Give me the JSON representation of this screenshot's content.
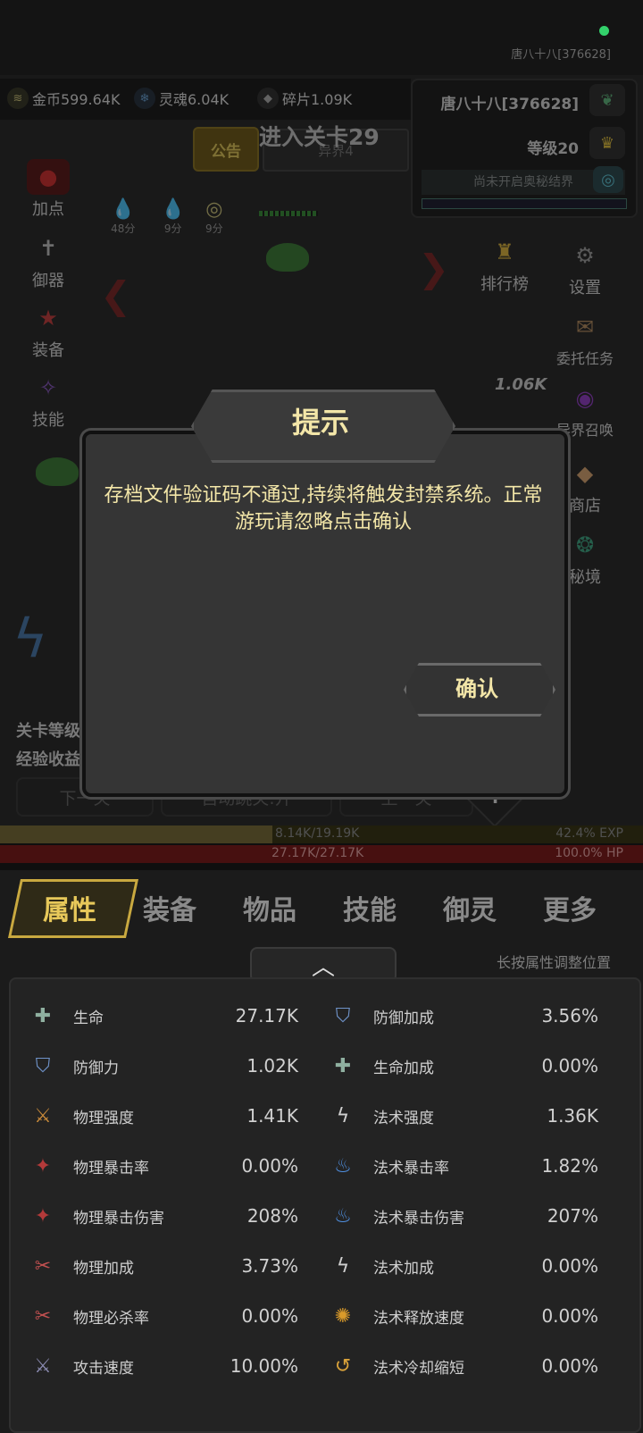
{
  "status": {
    "user": "唐八十八[376628]"
  },
  "currency": [
    {
      "icon": "coin-icon",
      "label": "金币599.64K",
      "color": "#c9c07a",
      "glyph": "≋"
    },
    {
      "icon": "soul-icon",
      "label": "灵魂6.04K",
      "color": "#6aa0d0",
      "glyph": "❄"
    },
    {
      "icon": "fragment-icon",
      "label": "碎片1.09K",
      "color": "#aaaaaa",
      "glyph": "◆"
    }
  ],
  "profile": {
    "name": "唐八十八[376628]",
    "level": "等级20",
    "realm": "尚未开启奥秘结界"
  },
  "top": {
    "notice": "公告",
    "realm_tab": "异界4",
    "enter_stage": "进入关卡29"
  },
  "left_menu": [
    {
      "label": "加点",
      "icon": "meat-icon",
      "glyph": "🍖"
    },
    {
      "label": "御器",
      "icon": "sword-icon",
      "glyph": "✝"
    },
    {
      "label": "装备",
      "icon": "armor-icon",
      "glyph": "⛨"
    },
    {
      "label": "技能",
      "icon": "scroll-icon",
      "glyph": "📜"
    }
  ],
  "right_menu": [
    {
      "label": "排行榜",
      "icon": "trophy-icon",
      "glyph": "🏆"
    },
    {
      "label": "设置",
      "icon": "gear-icon",
      "glyph": "⚙"
    },
    {
      "label": "委托任务",
      "icon": "task-icon",
      "glyph": "✉"
    },
    {
      "label": "异界召唤",
      "icon": "portal-icon",
      "glyph": "◉"
    },
    {
      "label": "商店",
      "icon": "shop-icon",
      "glyph": "💎"
    },
    {
      "label": "秘境",
      "icon": "secret-realm-icon",
      "glyph": "❂"
    }
  ],
  "buffs": [
    "48分",
    "9分",
    "9分"
  ],
  "damage_text": "1.06K",
  "stage_info": {
    "line1": "关卡等级",
    "line2": "经验收益"
  },
  "controls": {
    "next": "下一关",
    "auto": "自动跳关:开",
    "prev": "上一关"
  },
  "exp": {
    "text": "8.14K/19.19K",
    "pct": "42.4% EXP",
    "fraction": 0.424
  },
  "hp": {
    "text": "27.17K/27.17K",
    "pct": "100.0%  HP",
    "fraction": 1.0
  },
  "dialog": {
    "title": "提示",
    "message": "存档文件验证码不通过,持续将触发封禁系统。正常游玩请忽略点击确认",
    "confirm": "确认"
  },
  "tabs": [
    "属性",
    "装备",
    "物品",
    "技能",
    "御灵",
    "更多"
  ],
  "hint": "长按属性调整位置",
  "attributes_left": [
    {
      "name": "生命",
      "value": "27.17K",
      "icon": "life-icon",
      "glyph": "✚",
      "color": "#8fb0a0"
    },
    {
      "name": "防御力",
      "value": "1.02K",
      "icon": "shield-icon",
      "glyph": "⛉",
      "color": "#6f93c9"
    },
    {
      "name": "物理强度",
      "value": "1.41K",
      "icon": "blade-icon",
      "glyph": "⚔",
      "color": "#c98a3a"
    },
    {
      "name": "物理暴击率",
      "value": "0.00%",
      "icon": "phys-crit-icon",
      "glyph": "✦",
      "color": "#b43a3a"
    },
    {
      "name": "物理暴击伤害",
      "value": "208%",
      "icon": "phys-crit-dmg-icon",
      "glyph": "✦",
      "color": "#b43a3a"
    },
    {
      "name": "物理加成",
      "value": "3.73%",
      "icon": "phys-bonus-icon",
      "glyph": "✂",
      "color": "#c05050"
    },
    {
      "name": "物理必杀率",
      "value": "0.00%",
      "icon": "phys-kill-icon",
      "glyph": "✂",
      "color": "#c05050"
    },
    {
      "name": "攻击速度",
      "value": "10.00%",
      "icon": "attack-speed-icon",
      "glyph": "⚔",
      "color": "#8a8ab0"
    }
  ],
  "attributes_right": [
    {
      "name": "防御加成",
      "value": "3.56%",
      "icon": "defense-bonus-icon",
      "glyph": "⛉",
      "color": "#6f93c9"
    },
    {
      "name": "生命加成",
      "value": "0.00%",
      "icon": "life-bonus-icon",
      "glyph": "✚",
      "color": "#8fb0a0"
    },
    {
      "name": "法术强度",
      "value": "1.36K",
      "icon": "lightning-icon",
      "glyph": "ϟ",
      "color": "#cfcfcf"
    },
    {
      "name": "法术暴击率",
      "value": "1.82%",
      "icon": "blue-flame-icon",
      "glyph": "♨",
      "color": "#4f8fe0"
    },
    {
      "name": "法术暴击伤害",
      "value": "207%",
      "icon": "blue-flame-icon",
      "glyph": "♨",
      "color": "#4f8fe0"
    },
    {
      "name": "法术加成",
      "value": "0.00%",
      "icon": "lightning-icon",
      "glyph": "ϟ",
      "color": "#cfcfcf"
    },
    {
      "name": "法术释放速度",
      "value": "0.00%",
      "icon": "cast-speed-icon",
      "glyph": "✺",
      "color": "#d99a2a"
    },
    {
      "name": "法术冷却缩短",
      "value": "0.00%",
      "icon": "cooldown-icon",
      "glyph": "↺",
      "color": "#d9a23a"
    }
  ]
}
